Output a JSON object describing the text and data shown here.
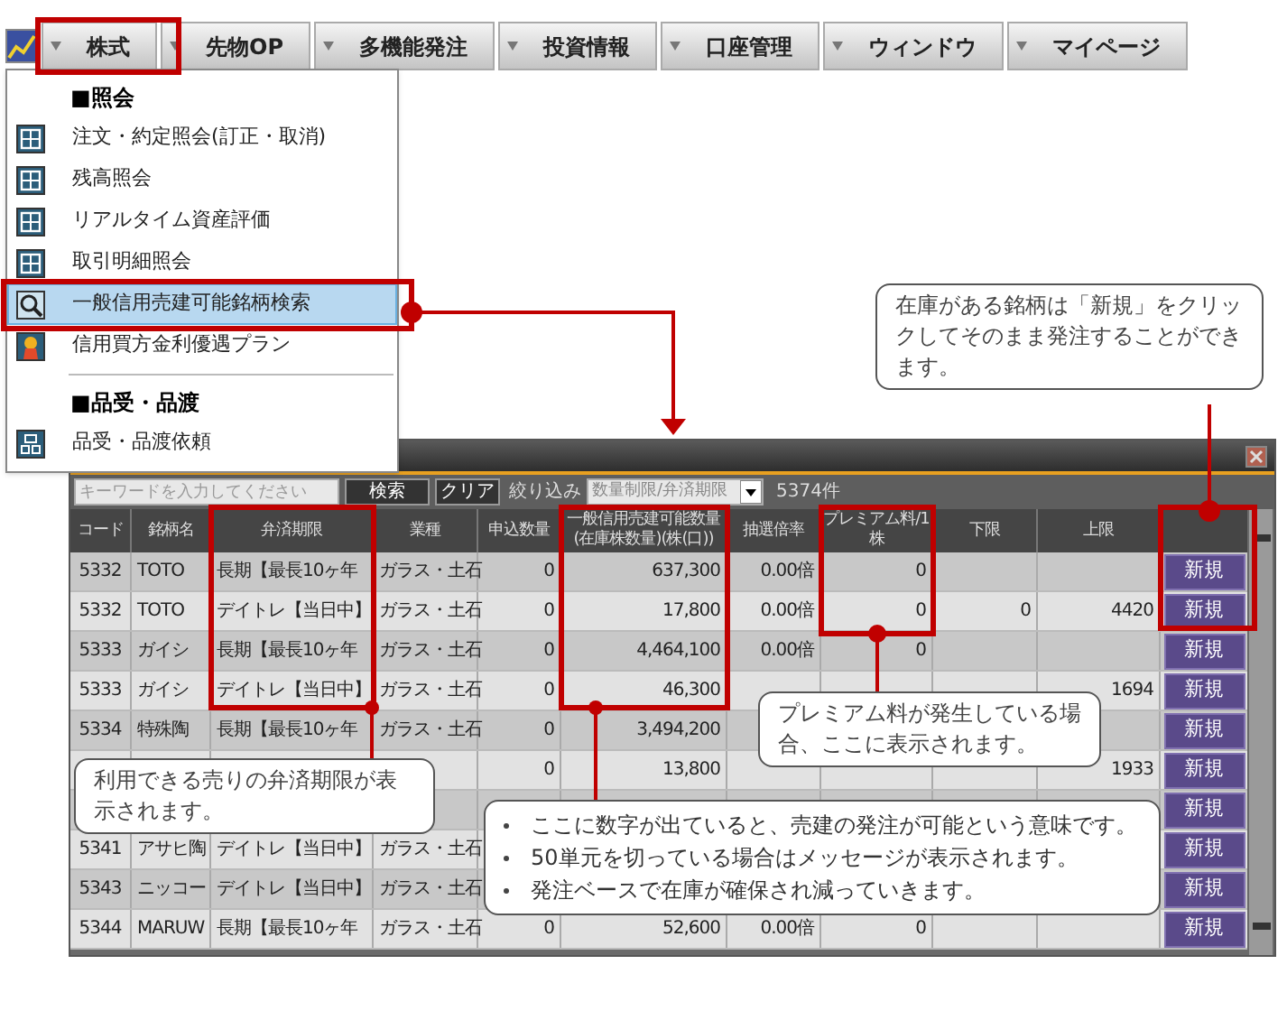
{
  "menu_bar": {
    "tabs": [
      {
        "label": "株式"
      },
      {
        "label": "先物OP"
      },
      {
        "label": "多機能発注"
      },
      {
        "label": "投資情報"
      },
      {
        "label": "口座管理"
      },
      {
        "label": "ウィンドウ"
      },
      {
        "label": "マイページ"
      }
    ]
  },
  "dropdown": {
    "sections": [
      {
        "header": "■照会",
        "items": [
          {
            "label": "注文・約定照会(訂正・取消)",
            "selected": false
          },
          {
            "label": "残高照会",
            "selected": false
          },
          {
            "label": "リアルタイム資産評価",
            "selected": false
          },
          {
            "label": "取引明細照会",
            "selected": false
          },
          {
            "label": "一般信用売建可能銘柄検索",
            "selected": true
          },
          {
            "label": "信用買方金利優遇プラン",
            "selected": false
          }
        ]
      },
      {
        "header": "■品受・品渡",
        "items": [
          {
            "label": "品受・品渡依頼",
            "selected": false
          }
        ]
      }
    ]
  },
  "window": {
    "search": {
      "placeholder": "キーワードを入力してください"
    },
    "search_button": "検索",
    "clear_button": "クリア",
    "filter_label": "絞り込み",
    "filter_select": "数量制限/弁済期限",
    "count": "5374件",
    "table": {
      "columns": [
        "コード",
        "銘柄名",
        "弁済期限",
        "業種",
        "申込数量",
        "一般信用売建可能数量\n(在庫株数量)(株(口))",
        "抽選倍率",
        "プレミアム料/1株",
        "下限",
        "上限"
      ],
      "rows": [
        {
          "cells": [
            "5332",
            "TOTO",
            "長期【最長10ヶ年",
            "ガラス・土石",
            "0",
            "637,300",
            "0.00倍",
            "0",
            null,
            null
          ],
          "button": "新規"
        },
        {
          "cells": [
            "5332",
            "TOTO",
            "デイトレ【当日中】",
            "ガラス・土石",
            "0",
            "17,800",
            "0.00倍",
            "0",
            "0",
            "4420"
          ],
          "button": "新規"
        },
        {
          "cells": [
            "5333",
            "ガイシ",
            "長期【最長10ヶ年",
            "ガラス・土石",
            "0",
            "4,464,100",
            "0.00倍",
            "0",
            null,
            null
          ],
          "button": "新規"
        },
        {
          "cells": [
            "5333",
            "ガイシ",
            "デイトレ【当日中】",
            "ガラス・土石",
            "0",
            "46,300",
            null,
            null,
            null,
            "1694"
          ],
          "button": "新規"
        },
        {
          "cells": [
            "5334",
            "特殊陶",
            "長期【最長10ヶ年",
            "ガラス・土石",
            "0",
            "3,494,200",
            null,
            null,
            null,
            null
          ],
          "button": "新規"
        },
        {
          "cells": [
            null,
            null,
            null,
            null,
            "0",
            "13,800",
            null,
            null,
            null,
            "1933"
          ],
          "button": "新規"
        },
        {
          "cells": [
            null,
            null,
            null,
            null,
            null,
            null,
            null,
            null,
            null,
            null
          ],
          "button": "新規"
        },
        {
          "cells": [
            "5341",
            "アサヒ陶",
            "デイトレ【当日中】",
            "ガラス・土石",
            null,
            null,
            null,
            null,
            null,
            null
          ],
          "button": "新規"
        },
        {
          "cells": [
            "5343",
            "ニッコー",
            "デイトレ【当日中】",
            "ガラス・土石",
            null,
            null,
            null,
            null,
            null,
            null
          ],
          "button": "新規"
        },
        {
          "cells": [
            "5344",
            "MARUW",
            "長期【最長10ヶ年",
            "ガラス・土石",
            "0",
            "52,600",
            "0.00倍",
            "0",
            null,
            null
          ],
          "button": "新規"
        }
      ]
    }
  },
  "callouts": [
    {
      "kind": "text",
      "text": "在庫がある銘柄は「新規」をクリックしてそのまま発注することができます。"
    },
    {
      "kind": "text",
      "text": "プレミアム料が発生している場合、ここに表示されます。"
    },
    {
      "kind": "text",
      "text": "利用できる売りの弁済期限が表示されます。"
    },
    {
      "kind": "bullets",
      "items": [
        "ここに数字が出ていると、売建の発注が可能という意味です。",
        "50単元を切っている場合はメッセージが表示されます。",
        "発注ベースで在庫が確保され減っていきます。"
      ]
    }
  ]
}
